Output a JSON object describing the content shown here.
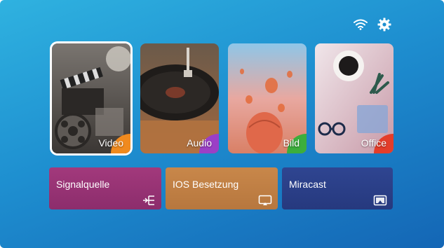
{
  "topbar": {
    "icons": [
      "wifi-icon",
      "gear-icon"
    ]
  },
  "tiles": [
    {
      "label": "Video",
      "accent": "#f08a1e",
      "selected": true
    },
    {
      "label": "Audio",
      "accent": "#9b3fc6",
      "selected": false
    },
    {
      "label": "Bild",
      "accent": "#3cae3c",
      "selected": false
    },
    {
      "label": "Office",
      "accent": "#e43d2a",
      "selected": false
    }
  ],
  "wide": [
    {
      "label": "Signalquelle",
      "icon": "input-source-icon",
      "color": "#9c3577"
    },
    {
      "label": "IOS Besetzung",
      "icon": "screen-mirror-icon",
      "color": "#c07f45"
    },
    {
      "label": "Miracast",
      "icon": "cast-icon",
      "color": "#2b418a"
    }
  ],
  "colors": {
    "background": "#1e8fd0"
  }
}
